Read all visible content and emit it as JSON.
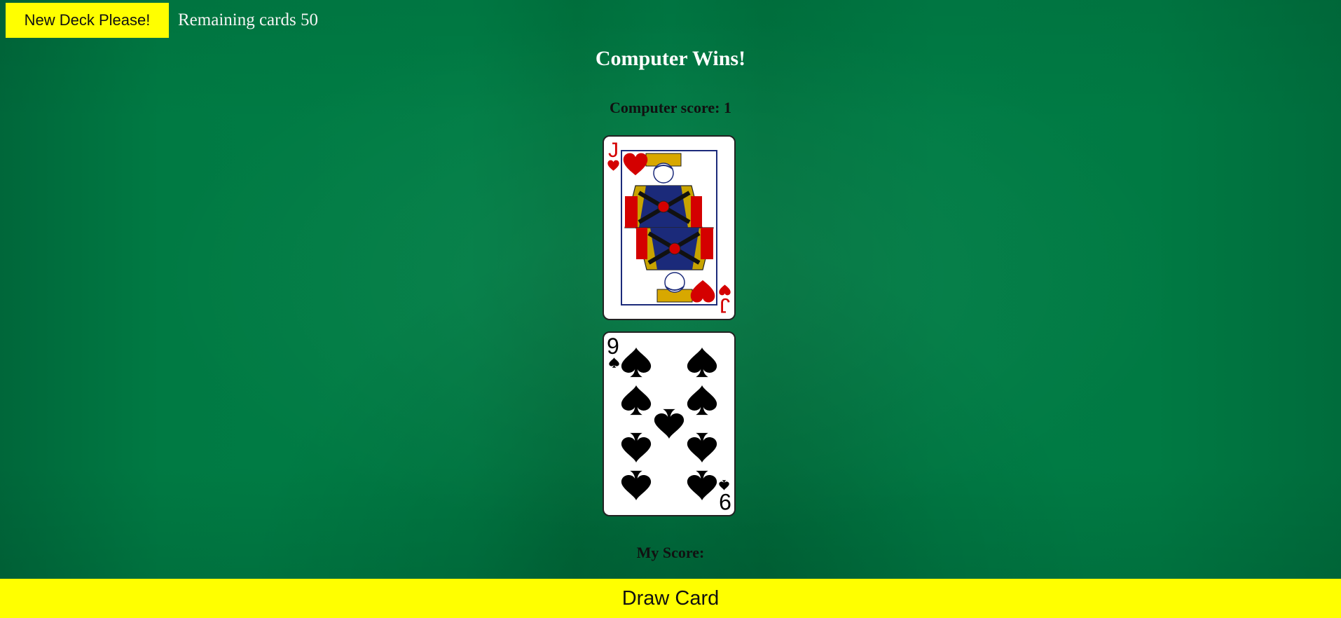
{
  "header": {
    "new_deck_label": "New Deck Please!",
    "remaining_text": "Remaining cards 50"
  },
  "result": {
    "winner_text": "Computer Wins!",
    "computer_score_text": "Computer score: 1",
    "my_score_text": "My Score:"
  },
  "cards": [
    {
      "rank": "J",
      "suit": "hearts",
      "color": "#d40000"
    },
    {
      "rank": "9",
      "suit": "spades",
      "color": "#000000"
    }
  ],
  "footer": {
    "draw_label": "Draw Card"
  },
  "colors": {
    "felt": "#007a43",
    "button": "#ffff00",
    "heart_red": "#d40000"
  }
}
